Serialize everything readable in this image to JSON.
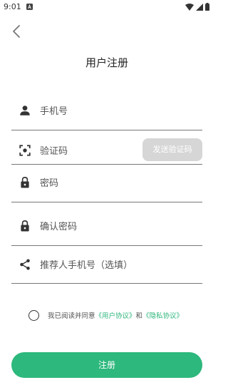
{
  "status_bar": {
    "time": "9:01",
    "notification_icon": "a-notification-icon",
    "wifi_icon": "wifi-icon",
    "signal_icon": "signal-icon",
    "battery_icon": "battery-icon"
  },
  "header": {
    "back_icon": "chevron-left-icon",
    "title": "用户注册"
  },
  "form": {
    "phone": {
      "icon": "person-icon",
      "placeholder": "手机号",
      "value": ""
    },
    "code": {
      "icon": "scan-focus-icon",
      "placeholder": "验证码",
      "value": "",
      "send_button_label": "发送验证码"
    },
    "password": {
      "icon": "lock-icon",
      "placeholder": "密码",
      "value": ""
    },
    "confirm_password": {
      "icon": "lock-icon",
      "placeholder": "确认密码",
      "value": ""
    },
    "referrer": {
      "icon": "share-icon",
      "placeholder": "推荐人手机号（选填）",
      "value": ""
    }
  },
  "agreement": {
    "prefix": "我已阅读并同意",
    "user_agreement": "《用户协议》",
    "and": "和",
    "privacy_agreement": "《隐私协议》",
    "checked": false
  },
  "submit": {
    "label": "注册"
  },
  "colors": {
    "accent": "#2db87d",
    "disabled_button": "#d6d6d6",
    "divider": "#777777"
  }
}
